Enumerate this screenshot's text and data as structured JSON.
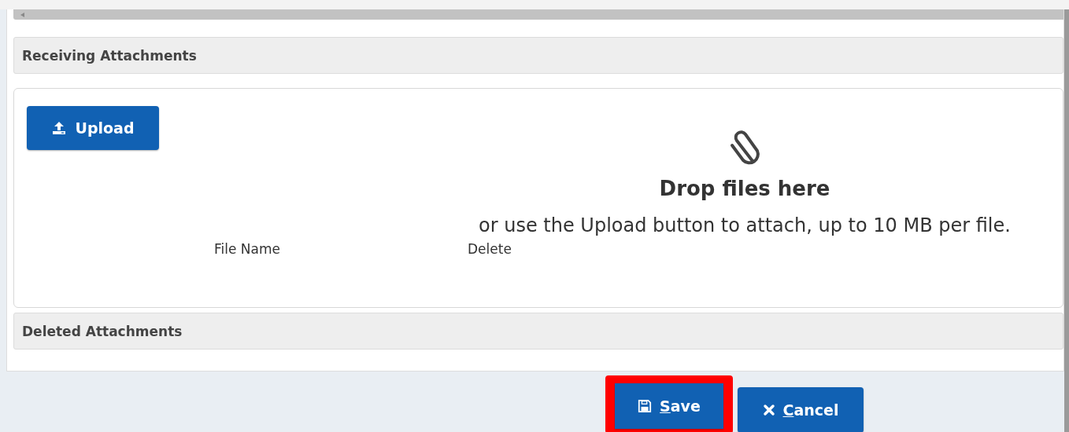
{
  "sections": [
    {
      "kind": "header",
      "title": "Receiving Attachments"
    },
    {
      "kind": "dropzone",
      "upload_button": {
        "label": "Upload"
      },
      "drop_title": "Drop files here",
      "drop_hint": "or use the Upload button to attach, up to 10 MB per file.",
      "columns": [
        "File Name",
        "Delete"
      ]
    },
    {
      "kind": "header",
      "title": "Deleted Attachments"
    }
  ],
  "buttons": [
    {
      "kind": "save",
      "label": "Save",
      "highlighted": true
    },
    {
      "kind": "cancel",
      "label": "Cancel",
      "highlighted": false
    }
  ]
}
